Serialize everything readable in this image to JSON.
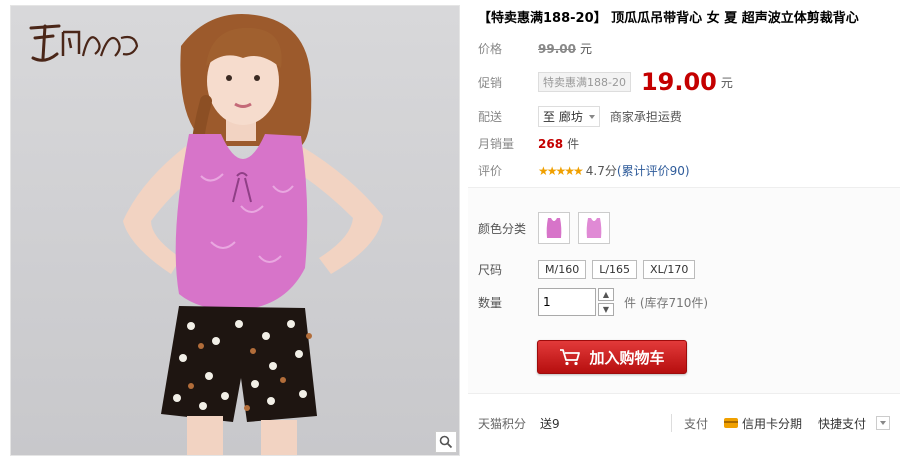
{
  "title": "【特卖惠满188-20】 顶瓜瓜吊带背心 女 夏 超声波立体剪裁背心",
  "price": {
    "label": "价格",
    "original": "99.00",
    "unit": "元"
  },
  "promo": {
    "label": "促销",
    "tag": "特卖惠满188-20",
    "price": "19.00",
    "unit": "元"
  },
  "delivery": {
    "label": "配送",
    "destination": "至 廊坊",
    "shipping": "商家承担运费"
  },
  "monthly_sales": {
    "label": "月销量",
    "count": "268",
    "unit": "件"
  },
  "review": {
    "label": "评价",
    "stars": "★★★★★",
    "score": "4.7分",
    "count_text": "(累计评价90)"
  },
  "options": {
    "color_label": "颜色分类",
    "size_label": "尺码",
    "sizes": [
      "M/160",
      "L/165",
      "XL/170"
    ],
    "qty_label": "数量",
    "qty_value": "1",
    "stock": "件 (库存710件)"
  },
  "cart_button": "加入购物车",
  "footer": {
    "points_label": "天猫积分",
    "points_value": "送9",
    "pay_label": "支付",
    "credit": "信用卡分期",
    "express": "快捷支付"
  },
  "colors": {
    "accent": "#c40000",
    "cart": "#c8161d",
    "product": "#d774c9"
  }
}
